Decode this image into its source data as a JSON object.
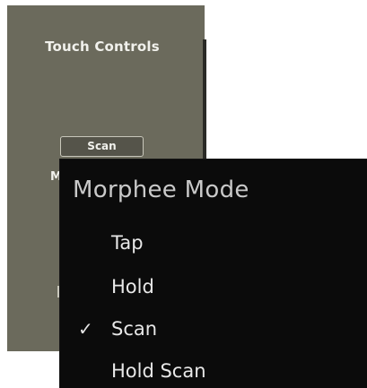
{
  "panel": {
    "title": "Touch Controls",
    "scan_button_label": "Scan",
    "partial_label": "M"
  },
  "menu": {
    "title": "Morphee Mode",
    "checkmark": "✓",
    "items": [
      {
        "label": "Tap",
        "checked": false
      },
      {
        "label": "Hold",
        "checked": false
      },
      {
        "label": "Scan",
        "checked": true
      },
      {
        "label": "Hold Scan",
        "checked": false
      }
    ]
  },
  "colors": {
    "panel_bg": "#6b6a5c",
    "menu_bg": "#0b0b0b",
    "menu_text": "#e8e8e8",
    "menu_title": "#c9c9c9"
  }
}
